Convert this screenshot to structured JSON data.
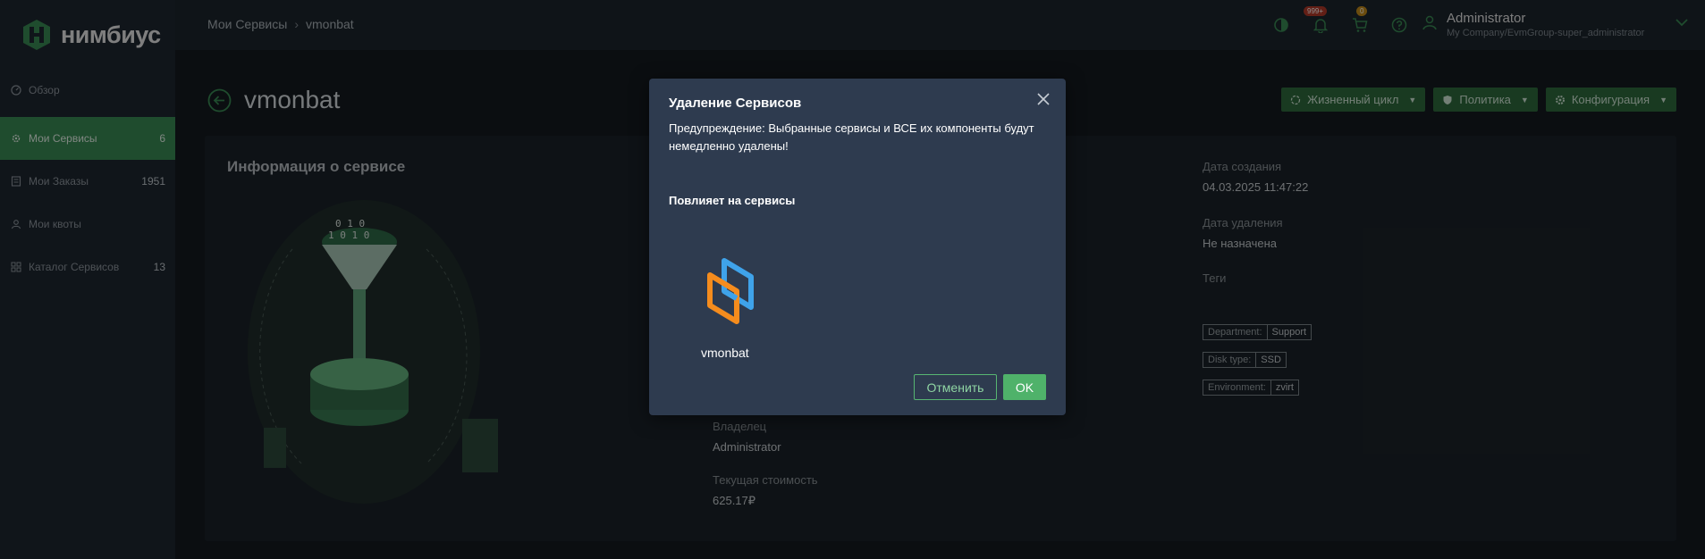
{
  "app": {
    "logo_text": "нимбиус"
  },
  "sidebar": {
    "items": [
      {
        "label": "Обзор",
        "count": "",
        "icon": "gauge-icon"
      },
      {
        "label": "Мои Сервисы",
        "count": "6",
        "icon": "gear-icon",
        "active": true
      },
      {
        "label": "Мои Заказы",
        "count": "1951",
        "icon": "order-icon"
      },
      {
        "label": "Мои квоты",
        "count": "",
        "icon": "user-icon"
      },
      {
        "label": "Каталог Сервисов",
        "count": "13",
        "icon": "grid-icon"
      }
    ]
  },
  "header": {
    "breadcrumb": [
      "Мои Сервисы",
      "vmonbat"
    ],
    "notifications_badge": "999+",
    "cart_badge": "0",
    "user_name": "Administrator",
    "user_org": "My Company/EvmGroup-super_administrator"
  },
  "page": {
    "title": "vmonbat",
    "buttons": [
      "Жизненный цикл",
      "Политика",
      "Конфигурация"
    ]
  },
  "card": {
    "title": "Информация о сервисе",
    "created_label": "Дата создания",
    "created_value": "04.03.2025 11:47:22",
    "deleted_label": "Дата удаления",
    "deleted_value": "Не назначена",
    "tags_label": "Теги",
    "tags": [
      {
        "key": "Department:",
        "value": "Support"
      },
      {
        "key": "Disk type:",
        "value": "SSD"
      },
      {
        "key": "Environment:",
        "value": "zvirt"
      }
    ],
    "owner_label": "Владелец",
    "owner_value": "Administrator",
    "cost_label": "Текущая стоимость",
    "cost_value": "625.17₽"
  },
  "modal": {
    "title": "Удаление Сервисов",
    "warning": "Предупреждение: Выбранные сервисы и ВСЕ их компоненты будут немедленно удалены!",
    "affects_label": "Повлияет на сервисы",
    "service_name": "vmonbat",
    "cancel_label": "Отменить",
    "ok_label": "OK"
  },
  "colors": {
    "accent": "#3a8b54",
    "modal_bg": "#2e3b4f",
    "ok_button": "#4fb26a"
  }
}
